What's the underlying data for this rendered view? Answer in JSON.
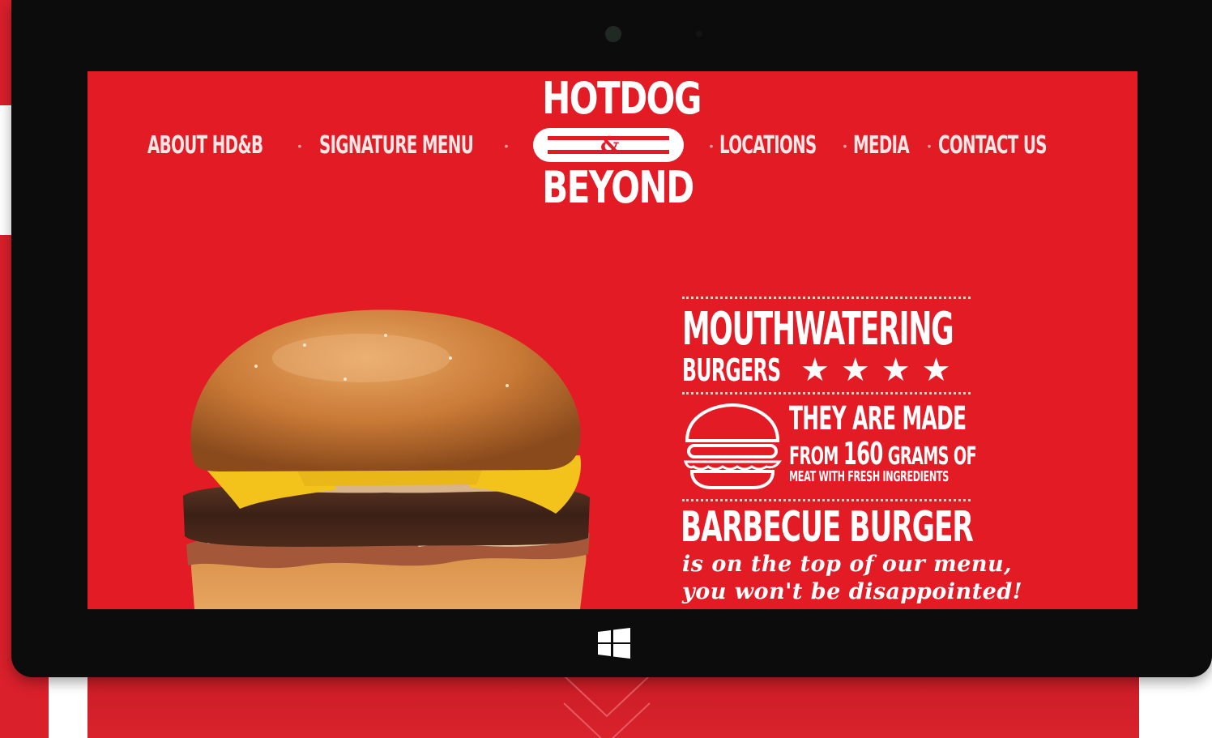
{
  "brand": {
    "logo_top": "HOTDOG",
    "logo_amp": "&",
    "logo_bottom": "BEYOND",
    "color_red": "#e31b25",
    "color_bezel": "#0c0c0c"
  },
  "nav": {
    "left": [
      {
        "label": "ABOUT HD&B"
      },
      {
        "label": "SIGNATURE MENU"
      }
    ],
    "right": [
      {
        "label": "LOCATIONS"
      },
      {
        "label": "MEDIA"
      },
      {
        "label": "CONTACT US"
      }
    ],
    "separator": "•"
  },
  "promo": {
    "headline": "MOUTHWATERING",
    "subline": "BURGERS",
    "stars": "★★★★",
    "rating": 4,
    "made_line1": "THEY ARE MADE",
    "made_from": "FROM",
    "made_amount": "160",
    "made_unit": "GRAMS OF",
    "made_line3": "MEAT WITH FRESH INGREDIENTS",
    "featured": "BARBECUE BURGER",
    "tagline1": "is on the top of our menu,",
    "tagline2": "you won't be disappointed!"
  },
  "icons": {
    "bun": "burger-outline-icon",
    "windows": "windows-logo-icon",
    "camera": "camera-icon",
    "scroll": "chevron-down-icon"
  }
}
